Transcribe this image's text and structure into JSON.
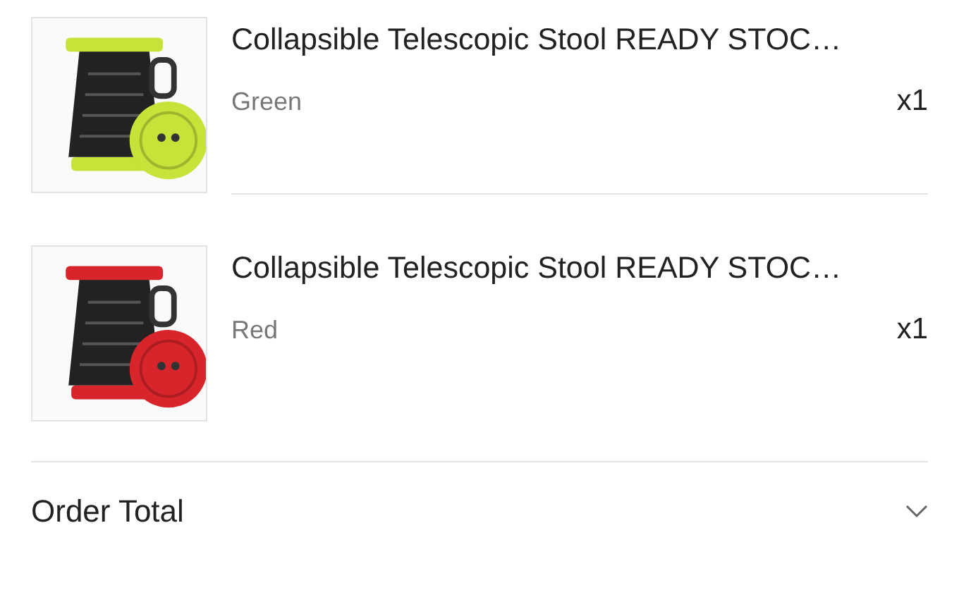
{
  "items": [
    {
      "title": "Collapsible Telescopic Stool READY STOC…",
      "variant": "Green",
      "quantity": "x1",
      "picture": {
        "color": "#c6e33a"
      }
    },
    {
      "title": "Collapsible Telescopic Stool READY STOC…",
      "variant": "Red",
      "quantity": "x1",
      "picture": {
        "color": "#d8252b"
      }
    }
  ],
  "order_total": {
    "label": "Order Total",
    "expanded": false
  }
}
